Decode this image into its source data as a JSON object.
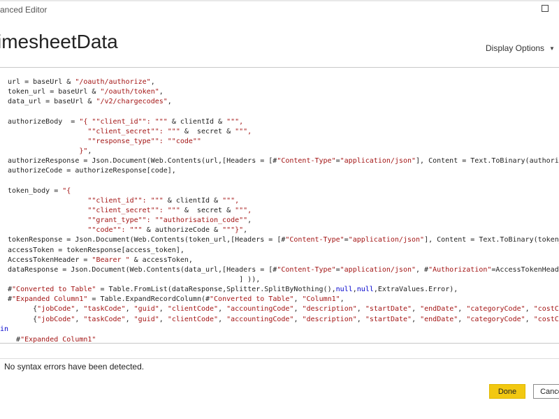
{
  "window": {
    "title": "anced Editor"
  },
  "header": {
    "query_name": "imesheetData",
    "display_options": "Display Options"
  },
  "colors": {
    "string": "#a31515",
    "keyword": "#0000cc",
    "done_button": "#f2c811"
  },
  "icons": {
    "maximize": "maximize-icon",
    "dropdown": "chevron-down-icon"
  },
  "editor": {
    "lines": [
      [
        {
          "t": "url = baseUrl & "
        },
        {
          "t": "\"/oauth/authorize\"",
          "c": "s"
        },
        {
          "t": ","
        }
      ],
      [
        {
          "t": "token_url = baseUrl & "
        },
        {
          "t": "\"/oauth/token\"",
          "c": "s"
        },
        {
          "t": ","
        }
      ],
      [
        {
          "t": "data_url = baseUrl & "
        },
        {
          "t": "\"/v2/chargecodes\"",
          "c": "s"
        },
        {
          "t": ","
        }
      ],
      [],
      [
        {
          "t": "authorizeBody  = "
        },
        {
          "t": "\"{ \"\"client_id\"\": \"\"\"",
          "c": "s"
        },
        {
          "t": " & clientId & "
        },
        {
          "t": "\"\"\",",
          "c": "s"
        }
      ],
      [
        {
          "t": "                   "
        },
        {
          "t": "\"\"client_secret\"\": \"\"\"",
          "c": "s"
        },
        {
          "t": " &  secret & "
        },
        {
          "t": "\"\"\",",
          "c": "s"
        }
      ],
      [
        {
          "t": "                   "
        },
        {
          "t": "\"\"response_type\"\": \"\"code\"\"",
          "c": "s"
        }
      ],
      [
        {
          "t": "                 "
        },
        {
          "t": "}\"",
          "c": "s"
        },
        {
          "t": ","
        }
      ],
      [
        {
          "t": "authorizeResponse = Json.Document(Web.Contents(url,[Headers = [#"
        },
        {
          "t": "\"Content-Type\"",
          "c": "s"
        },
        {
          "t": "="
        },
        {
          "t": "\"application/json\"",
          "c": "s"
        },
        {
          "t": "], Content = Text.ToBinary(authorizeBody)"
        }
      ],
      [
        {
          "t": "authorizeCode = authorizeResponse[code],"
        }
      ],
      [],
      [
        {
          "t": "token_body = "
        },
        {
          "t": "\"{",
          "c": "s"
        }
      ],
      [
        {
          "t": "                   "
        },
        {
          "t": "\"\"client_id\"\": \"\"\"",
          "c": "s"
        },
        {
          "t": " & clientId & "
        },
        {
          "t": "\"\"\",",
          "c": "s"
        }
      ],
      [
        {
          "t": "                   "
        },
        {
          "t": "\"\"client_secret\"\": \"\"\"",
          "c": "s"
        },
        {
          "t": " &  secret & "
        },
        {
          "t": "\"\"\",",
          "c": "s"
        }
      ],
      [
        {
          "t": "                   "
        },
        {
          "t": "\"\"grant_type\"\": \"\"authorisation_code\"\"",
          "c": "s"
        },
        {
          "t": ","
        }
      ],
      [
        {
          "t": "                   "
        },
        {
          "t": "\"\"code\"\": \"\"\"",
          "c": "s"
        },
        {
          "t": " & authorizeCode & "
        },
        {
          "t": "\"\"\"}\"",
          "c": "s"
        },
        {
          "t": ","
        }
      ],
      [
        {
          "t": "tokenResponse = Json.Document(Web.Contents(token_url,[Headers = [#"
        },
        {
          "t": "\"Content-Type\"",
          "c": "s"
        },
        {
          "t": "="
        },
        {
          "t": "\"application/json\"",
          "c": "s"
        },
        {
          "t": "], Content = Text.ToBinary(token_body)"
        }
      ],
      [
        {
          "t": "accessToken = tokenResponse[access_token],"
        }
      ],
      [
        {
          "t": "AccessTokenHeader = "
        },
        {
          "t": "\"Bearer \"",
          "c": "s"
        },
        {
          "t": " & accessToken,"
        }
      ],
      [
        {
          "t": "dataResponse = Json.Document(Web.Contents(data_url,[Headers = [#"
        },
        {
          "t": "\"Content-Type\"",
          "c": "s"
        },
        {
          "t": "="
        },
        {
          "t": "\"application/json\"",
          "c": "s"
        },
        {
          "t": ", #"
        },
        {
          "t": "\"Authorization\"",
          "c": "s"
        },
        {
          "t": "=AccessTokenHeader]"
        }
      ],
      [
        {
          "t": "                                                       ] )),"
        }
      ],
      [
        {
          "t": "#"
        },
        {
          "t": "\"Converted to Table\"",
          "c": "s"
        },
        {
          "t": " = Table.FromList(dataResponse,Splitter.SplitByNothing(),"
        },
        {
          "t": "null",
          "c": "k"
        },
        {
          "t": ","
        },
        {
          "t": "null",
          "c": "k"
        },
        {
          "t": ",ExtraValues.Error),"
        }
      ],
      [
        {
          "t": "#"
        },
        {
          "t": "\"Expanded Column1\"",
          "c": "s"
        },
        {
          "t": " = Table.ExpandRecordColumn(#"
        },
        {
          "t": "\"Converted to Table\"",
          "c": "s"
        },
        {
          "t": ", "
        },
        {
          "t": "\"Column1\"",
          "c": "s"
        },
        {
          "t": ","
        }
      ],
      [
        {
          "t": "      {"
        },
        {
          "t": "\"jobCode\"",
          "c": "s"
        },
        {
          "t": ", "
        },
        {
          "t": "\"taskCode\"",
          "c": "s"
        },
        {
          "t": ", "
        },
        {
          "t": "\"guid\"",
          "c": "s"
        },
        {
          "t": ", "
        },
        {
          "t": "\"clientCode\"",
          "c": "s"
        },
        {
          "t": ", "
        },
        {
          "t": "\"accountingCode\"",
          "c": "s"
        },
        {
          "t": ", "
        },
        {
          "t": "\"description\"",
          "c": "s"
        },
        {
          "t": ", "
        },
        {
          "t": "\"startDate\"",
          "c": "s"
        },
        {
          "t": ", "
        },
        {
          "t": "\"endDate\"",
          "c": "s"
        },
        {
          "t": ", "
        },
        {
          "t": "\"categoryCode\"",
          "c": "s"
        },
        {
          "t": ", "
        },
        {
          "t": "\"costCentreCo",
          "c": "s"
        }
      ],
      [
        {
          "t": "      {"
        },
        {
          "t": "\"jobCode\"",
          "c": "s"
        },
        {
          "t": ", "
        },
        {
          "t": "\"taskCode\"",
          "c": "s"
        },
        {
          "t": ", "
        },
        {
          "t": "\"guid\"",
          "c": "s"
        },
        {
          "t": ", "
        },
        {
          "t": "\"clientCode\"",
          "c": "s"
        },
        {
          "t": ", "
        },
        {
          "t": "\"accountingCode\"",
          "c": "s"
        },
        {
          "t": ", "
        },
        {
          "t": "\"description\"",
          "c": "s"
        },
        {
          "t": ", "
        },
        {
          "t": "\"startDate\"",
          "c": "s"
        },
        {
          "t": ", "
        },
        {
          "t": "\"endDate\"",
          "c": "s"
        },
        {
          "t": ", "
        },
        {
          "t": "\"categoryCode\"",
          "c": "s"
        },
        {
          "t": ", "
        },
        {
          "t": "\"costCentreCo",
          "c": "s"
        }
      ],
      [
        {
          "t": "in",
          "c": "k"
        }
      ],
      [
        {
          "t": "  #"
        },
        {
          "t": "\"Expanded Column1\"",
          "c": "s"
        }
      ]
    ]
  },
  "status": {
    "message": "No syntax errors have been detected."
  },
  "buttons": {
    "done": "Done",
    "cancel": "Cance"
  }
}
